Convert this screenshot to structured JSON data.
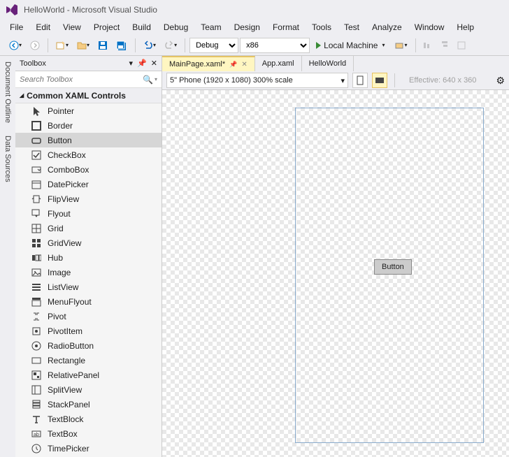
{
  "title": "HelloWorld - Microsoft Visual Studio",
  "menu": [
    "File",
    "Edit",
    "View",
    "Project",
    "Build",
    "Debug",
    "Team",
    "Design",
    "Format",
    "Tools",
    "Test",
    "Analyze",
    "Window",
    "Help"
  ],
  "toolbar": {
    "config": "Debug",
    "platform": "x86",
    "run_target": "Local Machine"
  },
  "left_rail": [
    "Document Outline",
    "Data Sources"
  ],
  "toolbox": {
    "title": "Toolbox",
    "search_placeholder": "Search Toolbox",
    "category": "Common XAML Controls",
    "selected": "Button",
    "items": [
      "Pointer",
      "Border",
      "Button",
      "CheckBox",
      "ComboBox",
      "DatePicker",
      "FlipView",
      "Flyout",
      "Grid",
      "GridView",
      "Hub",
      "Image",
      "ListView",
      "MenuFlyout",
      "Pivot",
      "PivotItem",
      "RadioButton",
      "Rectangle",
      "RelativePanel",
      "SplitView",
      "StackPanel",
      "TextBlock",
      "TextBox",
      "TimePicker"
    ]
  },
  "tabs": [
    {
      "label": "MainPage.xaml*",
      "active": true,
      "pinned": true
    },
    {
      "label": "App.xaml",
      "active": false
    },
    {
      "label": "HelloWorld",
      "active": false
    }
  ],
  "design_bar": {
    "device": "5\" Phone (1920 x 1080) 300% scale",
    "effective": "Effective: 640 x 360"
  },
  "canvas": {
    "button_label": "Button"
  }
}
